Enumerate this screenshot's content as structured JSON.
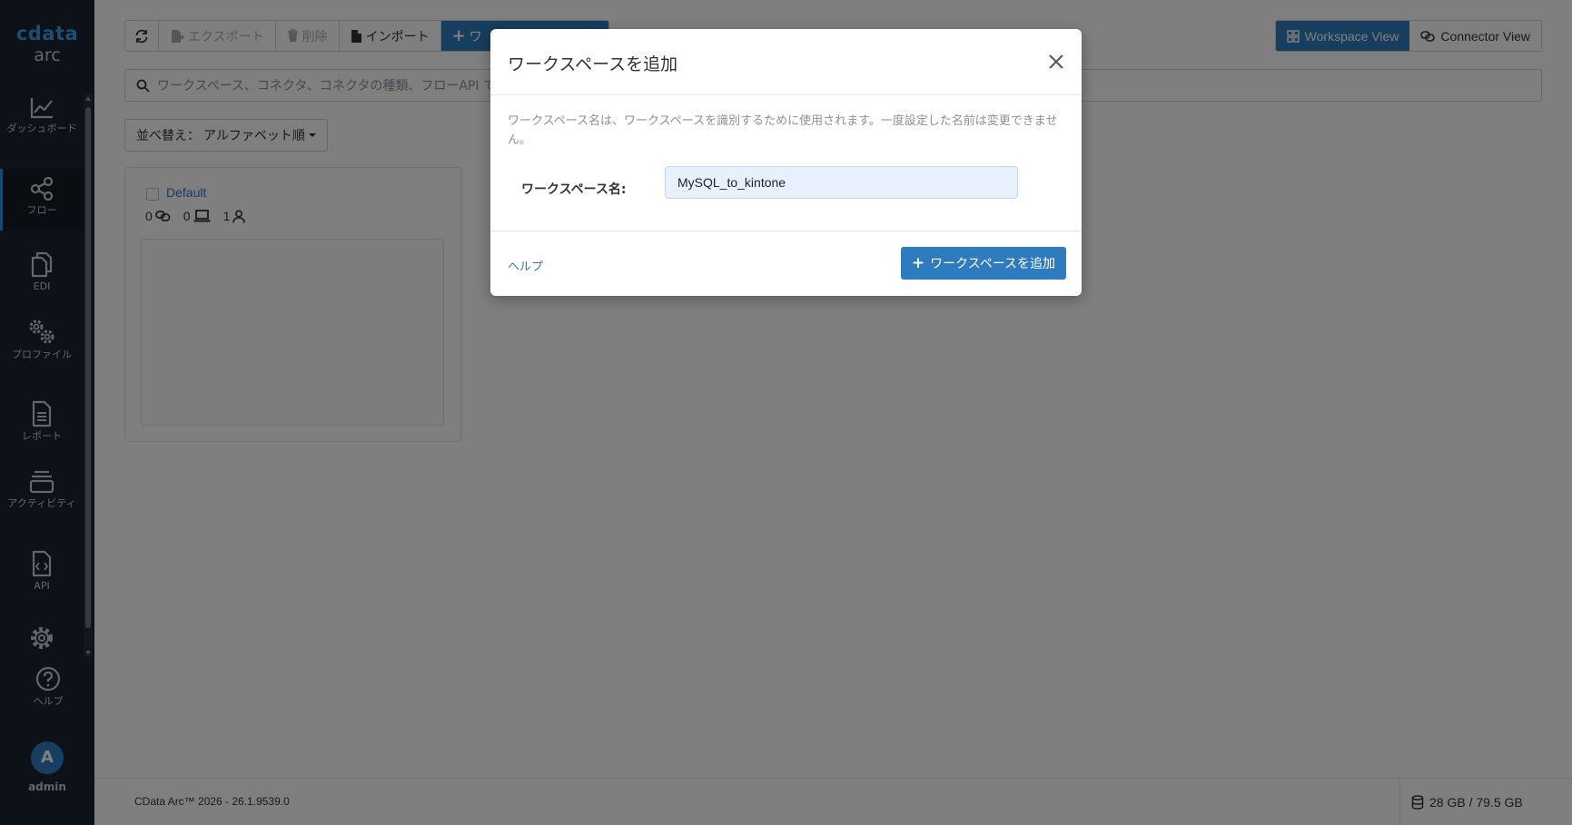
{
  "sidebar": {
    "logo_top": "cdata",
    "logo_bottom": "arc",
    "items": [
      {
        "label": "ダッシュボード",
        "icon": "chart-line-icon"
      },
      {
        "label": "フロー",
        "icon": "share-nodes-icon"
      },
      {
        "label": "EDI",
        "icon": "copy-icon"
      },
      {
        "label": "プロファイル",
        "icon": "gears-icon"
      },
      {
        "label": "レポート",
        "icon": "file-lines-icon"
      },
      {
        "label": "アクティビティ",
        "icon": "layers-icon"
      },
      {
        "label": "API",
        "icon": "file-code-icon"
      },
      {
        "label": "",
        "icon": "gear-icon"
      },
      {
        "label": "ヘルプ",
        "icon": "question-circle-icon"
      }
    ],
    "active_item": "フロー",
    "avatar_initial": "A",
    "user_name": "admin"
  },
  "toolbar": {
    "export_label": "エクスポート",
    "delete_label": "削除",
    "import_label": "インポート",
    "add_label": "ワ"
  },
  "views": {
    "workspace_label": "Workspace View",
    "connector_label": "Connector View",
    "active": "Workspace View"
  },
  "search": {
    "placeholder": "ワークスペース、コネクタ、コネクタの種類、フローAPI で"
  },
  "sort": {
    "label": "並べ替え：",
    "value": "アルファベット順"
  },
  "workspace_card": {
    "name": "Default",
    "connections": "0",
    "connectors": "0",
    "users": "1"
  },
  "footer": {
    "version": "CData Arc™ 2026 - 26.1.9539.0",
    "storage": "28 GB / 79.5 GB"
  },
  "modal": {
    "title": "ワークスペースを追加",
    "description": "ワークスペース名は、ワークスペースを識別するために使用されます。一度設定した名前は変更できません。",
    "field_label": "ワークスペース名:",
    "field_value": "MySQL_to_kintone",
    "help_link": "ヘルプ",
    "submit_label": "ワークスペースを追加"
  },
  "colors": {
    "primary": "#2f7bbf",
    "sidebar_bg": "#1b2330",
    "overlay": "rgba(0,0,0,0.5)"
  }
}
